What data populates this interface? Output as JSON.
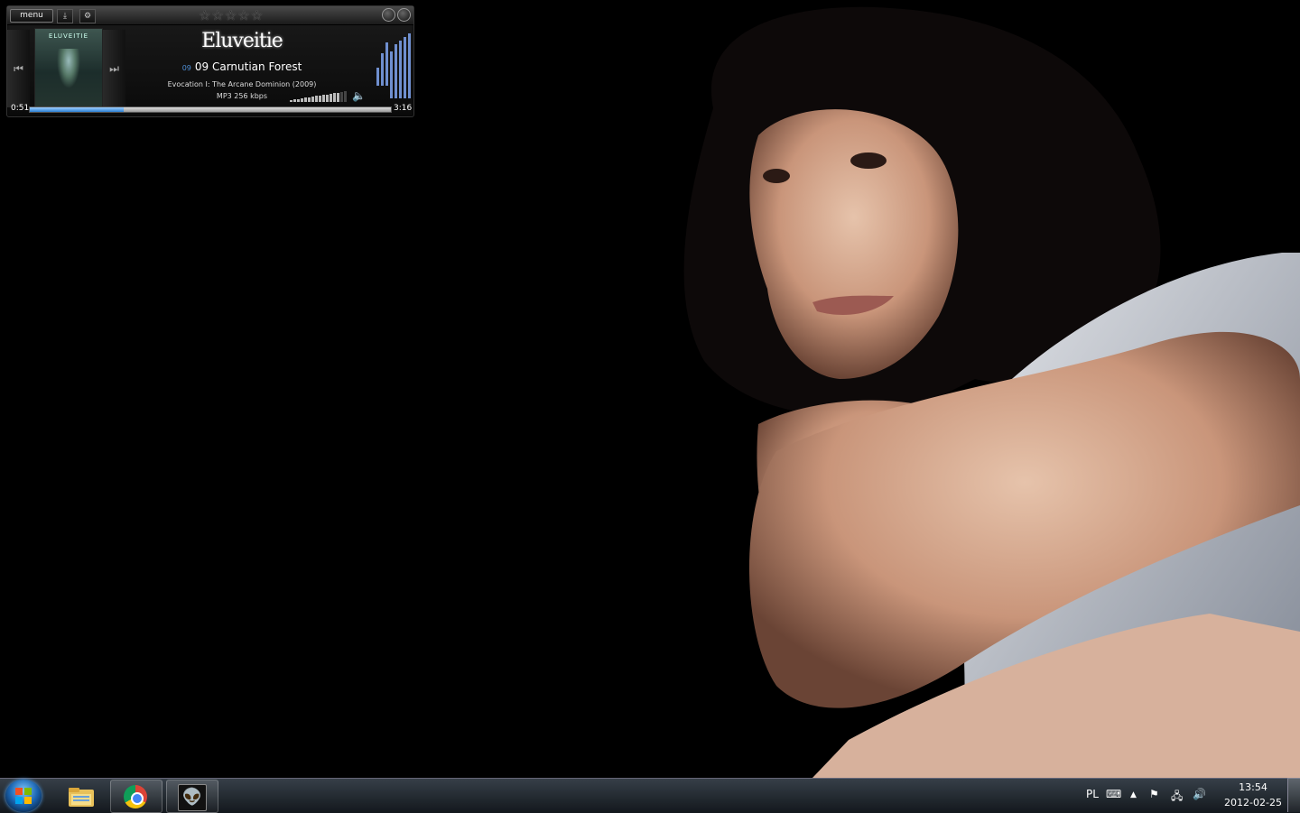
{
  "player": {
    "menu_label": "menu",
    "rating_stars": "☆☆☆☆☆",
    "band": "Eluveitie",
    "track_number": "09",
    "track_title": "09 Carnutian Forest",
    "album": "Evocation I: The Arcane Dominion (2009)",
    "quality": "MP3   256 kbps",
    "time_current": "0:51",
    "time_total": "3:16",
    "progress_fraction": 0.26,
    "volume_level": 0.9,
    "cover_text": "ELUVEITIE"
  },
  "taskbar": {
    "language": "PL",
    "clock_time": "13:54",
    "clock_date": "2012-02-25",
    "apps": [
      "Windows Explorer",
      "Google Chrome",
      "Alien app"
    ]
  },
  "icons": {
    "prev": "⏮",
    "next": "⏭",
    "speaker": "🔈",
    "tray_up": "▲",
    "flag": "⚑",
    "network": "🖧",
    "volume": "🔊",
    "keyboard": "⌨",
    "alien": "👽",
    "download": "⤓",
    "settings": "⚙"
  },
  "colors": {
    "accent_blue": "#2a7fd4",
    "track_number": "#4f8fd6"
  }
}
